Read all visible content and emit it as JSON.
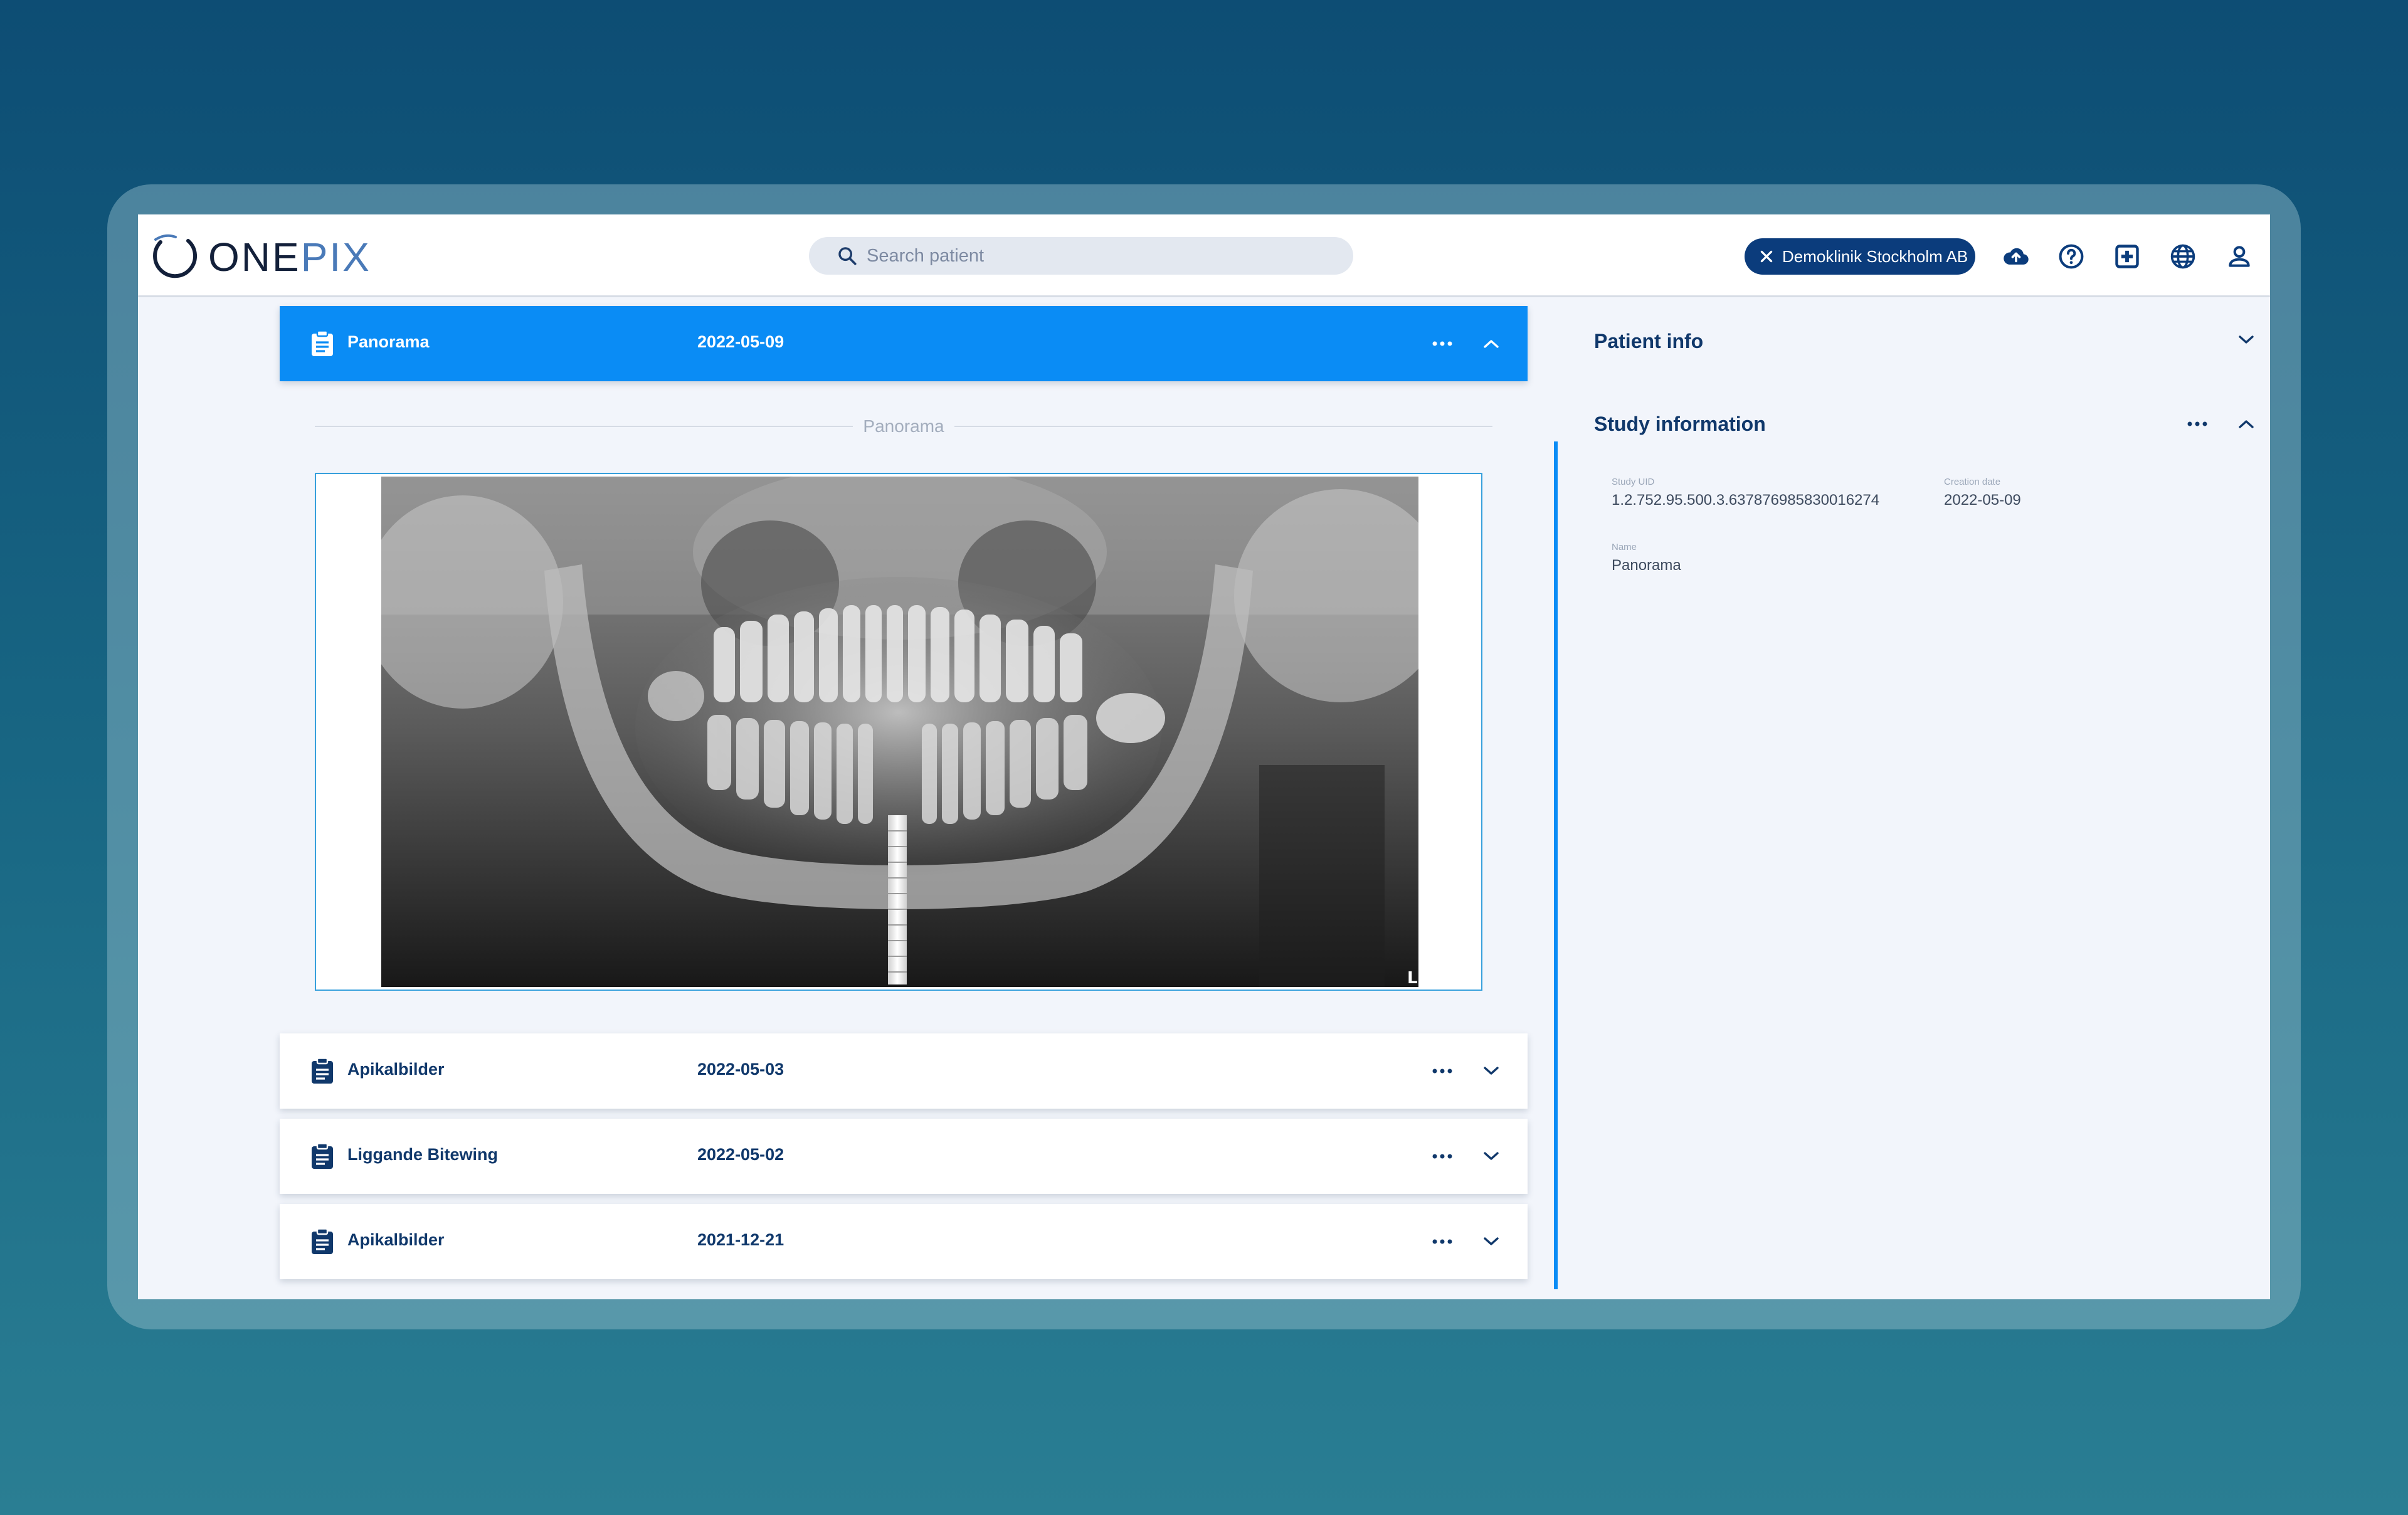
{
  "app": {
    "logo_one": "ONE",
    "logo_pix": "PIX"
  },
  "search": {
    "placeholder": "Search patient"
  },
  "clinic": {
    "label": "Demoklinik Stockholm AB"
  },
  "header_icons": [
    "cloud-upload-icon",
    "help-circle-icon",
    "medical-kit-icon",
    "globe-icon",
    "user-icon"
  ],
  "active_study": {
    "name": "Panorama",
    "date": "2022-05-09"
  },
  "image_section": {
    "label": "Panorama",
    "orientation_marker": "L"
  },
  "studies": [
    {
      "name": "Apikalbilder",
      "date": "2022-05-03"
    },
    {
      "name": "Liggande Bitewing",
      "date": "2022-05-02"
    },
    {
      "name": "Apikalbilder",
      "date": "2021-12-21"
    }
  ],
  "patient_info": {
    "title": "Patient info"
  },
  "study_information": {
    "title": "Study information",
    "uid_label": "Study UID",
    "uid_value": "1.2.752.95.500.3.637876985830016274",
    "date_label": "Creation date",
    "date_value": "2022-05-09",
    "name_label": "Name",
    "name_value": "Panorama"
  },
  "colors": {
    "brand_navy": "#0b3c7c",
    "active_blue": "#0a8cf5",
    "text_navy": "#10386b"
  }
}
